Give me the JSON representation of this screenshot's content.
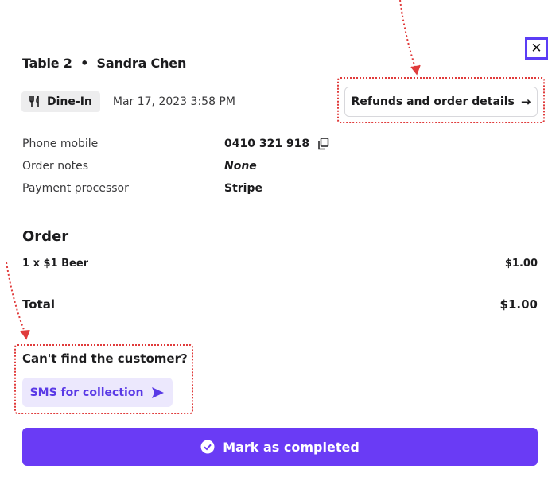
{
  "header": {
    "table_label": "Table 2",
    "separator": "•",
    "customer_name": "Sandra Chen",
    "close_icon": "close-icon"
  },
  "order_meta": {
    "type_label": "Dine-In",
    "type_icon": "fork-knife-icon",
    "date": "Mar 17, 2023 3:58 PM"
  },
  "refunds_button": {
    "label": "Refunds and order details",
    "icon": "arrow-right-icon"
  },
  "details": [
    {
      "label": "Phone mobile",
      "value": "0410 321 918",
      "icon": "copy-icon"
    },
    {
      "label": "Order notes",
      "value": "None"
    },
    {
      "label": "Payment processor",
      "value": "Stripe"
    }
  ],
  "order": {
    "heading": "Order",
    "items": [
      {
        "description": "1 x $1 Beer",
        "price": "$1.00"
      }
    ],
    "total_label": "Total",
    "total_value": "$1.00"
  },
  "customer": {
    "heading": "Can't find the customer?",
    "sms_button_label": "SMS for collection",
    "sms_icon": "send-icon"
  },
  "complete_button": {
    "label": "Mark as completed",
    "icon": "check-circle-icon"
  },
  "colors": {
    "accent": "#6a3bf5",
    "accent_light": "#ece8fd",
    "annotation": "#e03b3b",
    "close_outline": "#5b3df5"
  }
}
